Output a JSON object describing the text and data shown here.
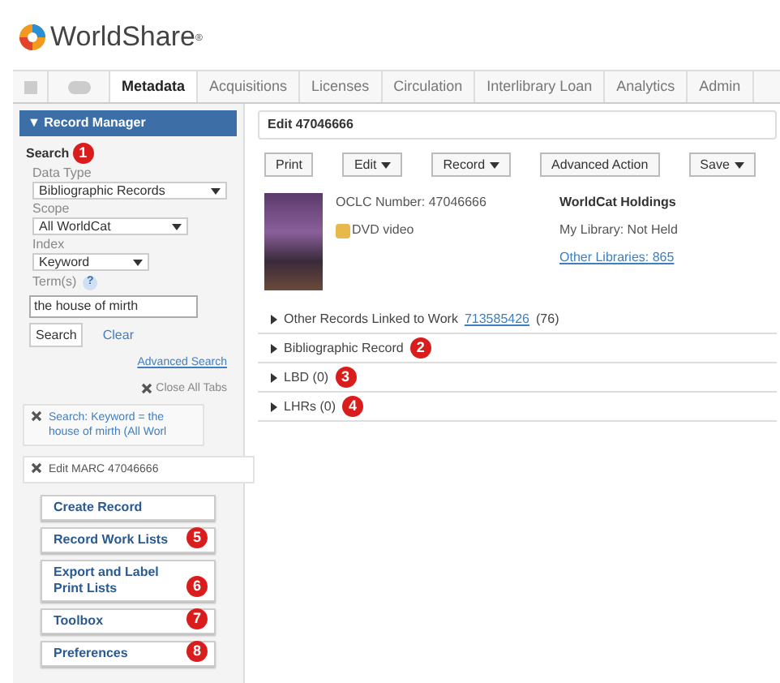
{
  "logo": {
    "text": "WorldShare",
    "mark": "®"
  },
  "tabs": [
    {
      "label": "Metadata",
      "selected": true
    },
    {
      "label": "Acquisitions",
      "selected": false
    },
    {
      "label": "Licenses",
      "selected": false
    },
    {
      "label": "Circulation",
      "selected": false
    },
    {
      "label": "Interlibrary Loan",
      "selected": false
    },
    {
      "label": "Analytics",
      "selected": false
    },
    {
      "label": "Admin",
      "selected": false
    }
  ],
  "sidebar": {
    "header": "▼ Record Manager",
    "search_title": "Search",
    "search_callout": "1",
    "fields": [
      {
        "label": "Data Type",
        "value": "Bibliographic Records"
      },
      {
        "label": "Scope",
        "value": "All WorldCat"
      },
      {
        "label": "Index",
        "value": "Keyword"
      }
    ],
    "terms_label": "Term(s)",
    "help": "?",
    "terms_value": "the house of mirth",
    "search_button": "Search",
    "clear": "Clear",
    "advanced": "Advanced Search",
    "close_all": "Close All Tabs",
    "open_tabs": [
      {
        "text": "Search: Keyword = the house of mirth (All Worl",
        "selected": false
      },
      {
        "text": "Edit MARC 47046666",
        "selected": true
      }
    ],
    "menu": [
      {
        "label": "Create Record"
      },
      {
        "label": "Record Work Lists",
        "callout": "5"
      },
      {
        "label": "Export and Label Print Lists",
        "callout": "6"
      },
      {
        "label": "Toolbox",
        "callout": "7"
      },
      {
        "label": "Preferences",
        "callout": "8"
      }
    ]
  },
  "main": {
    "title": "Edit 47046666",
    "toolbar": [
      {
        "label": "Print",
        "menu": false
      },
      {
        "label": "Edit",
        "menu": true
      },
      {
        "label": "Record",
        "menu": true
      },
      {
        "label": "Advanced Action",
        "menu": false
      },
      {
        "label": "Save",
        "menu": true
      }
    ],
    "oclc": "OCLC Number: 47046666",
    "format": "DVD video",
    "holdings_title": "WorldCat Holdings",
    "my_library": "My Library: Not Held",
    "other_libraries": "Other Libraries: 865",
    "sections": [
      {
        "label": "Other Records Linked to Work",
        "link": "713585426",
        "suffix": "(76)"
      },
      {
        "label": "Bibliographic Record",
        "callout": "2"
      },
      {
        "label": "LBD (0)",
        "callout": "3"
      },
      {
        "label": "LHRs (0)",
        "callout": "4"
      }
    ]
  }
}
